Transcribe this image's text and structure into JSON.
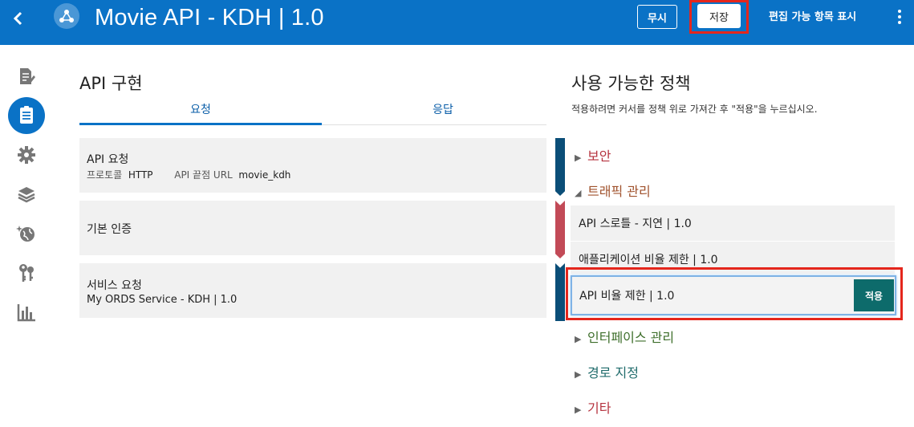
{
  "header": {
    "title": "Movie API - KDH | 1.0",
    "ignore_label": "무시",
    "save_label": "저장",
    "show_editable_label": "편집 가능 항목 표시"
  },
  "implementation": {
    "title": "API 구현",
    "tabs": [
      {
        "label": "요청",
        "active": true
      },
      {
        "label": "응답",
        "active": false
      }
    ],
    "cards": [
      {
        "title": "API 요청",
        "protocol_label": "프로토콜",
        "protocol_value": "HTTP",
        "endpoint_label": "API 끝점 URL",
        "endpoint_value": "movie_kdh"
      },
      {
        "title": "기본 인증"
      },
      {
        "title": "서비스 요청",
        "detail": "My ORDS Service - KDH | 1.0"
      }
    ]
  },
  "policies": {
    "title": "사용 가능한 정책",
    "hint": "적용하려면 커서를 정책 위로 가져간 후 \"적용\"을 누르십시오.",
    "groups": [
      {
        "label": "보안",
        "expanded": false,
        "color": "#b5323e"
      },
      {
        "label": "트래픽 관리",
        "expanded": true,
        "color": "#a0522d"
      },
      {
        "label": "인터페이스 관리",
        "expanded": false,
        "color": "#3d6e2a"
      },
      {
        "label": "경로 지정",
        "expanded": false,
        "color": "#1f6b6b"
      },
      {
        "label": "기타",
        "expanded": false,
        "color": "#b5323e"
      }
    ],
    "traffic_items": [
      "API 스로틀 - 지연 | 1.0",
      "애플리케이션 비율 제한 | 1.0",
      "API 비율 제한 | 1.0"
    ],
    "apply_label": "적용"
  },
  "rail_icons": [
    "document-edit-icon",
    "api-list-icon",
    "gear-icon",
    "layers-icon",
    "globe-icon",
    "keys-icon",
    "bar-chart-icon"
  ]
}
